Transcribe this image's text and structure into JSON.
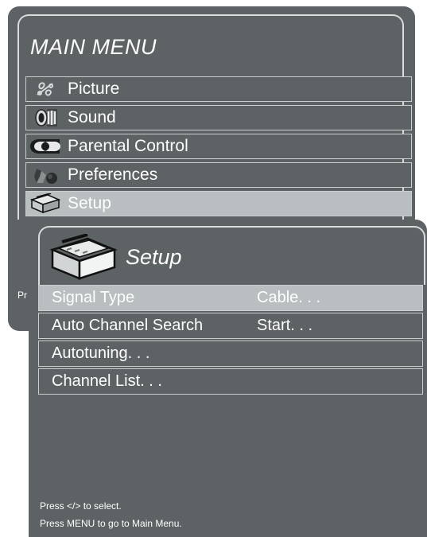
{
  "main_menu": {
    "title": "MAIN MENU",
    "items": [
      {
        "label": "Picture",
        "icon": "picture-icon",
        "selected": false
      },
      {
        "label": "Sound",
        "icon": "speaker-icon",
        "selected": false
      },
      {
        "label": "Parental Control",
        "icon": "parental-control-icon",
        "selected": false
      },
      {
        "label": "Preferences",
        "icon": "preferences-icon",
        "selected": false
      },
      {
        "label": "Setup",
        "icon": "setup-toolbox-icon",
        "selected": true
      }
    ],
    "hidden_text": "Pr"
  },
  "setup_menu": {
    "title": "Setup",
    "icon": "setup-toolbox-icon",
    "rows": [
      {
        "name": "Signal Type",
        "value": "Cable. . .",
        "selected": true
      },
      {
        "name": "Auto Channel Search",
        "value": "Start. . .",
        "selected": false
      },
      {
        "name": "Autotuning. . .",
        "value": "",
        "selected": false
      },
      {
        "name": "Channel List. . .",
        "value": "",
        "selected": false
      }
    ],
    "help": [
      "Press </> to select.",
      "Press MENU to go to Main Menu."
    ]
  },
  "colors": {
    "panel": "#5d6264",
    "highlight": "#b9bec0",
    "border": "#c9cecf"
  }
}
